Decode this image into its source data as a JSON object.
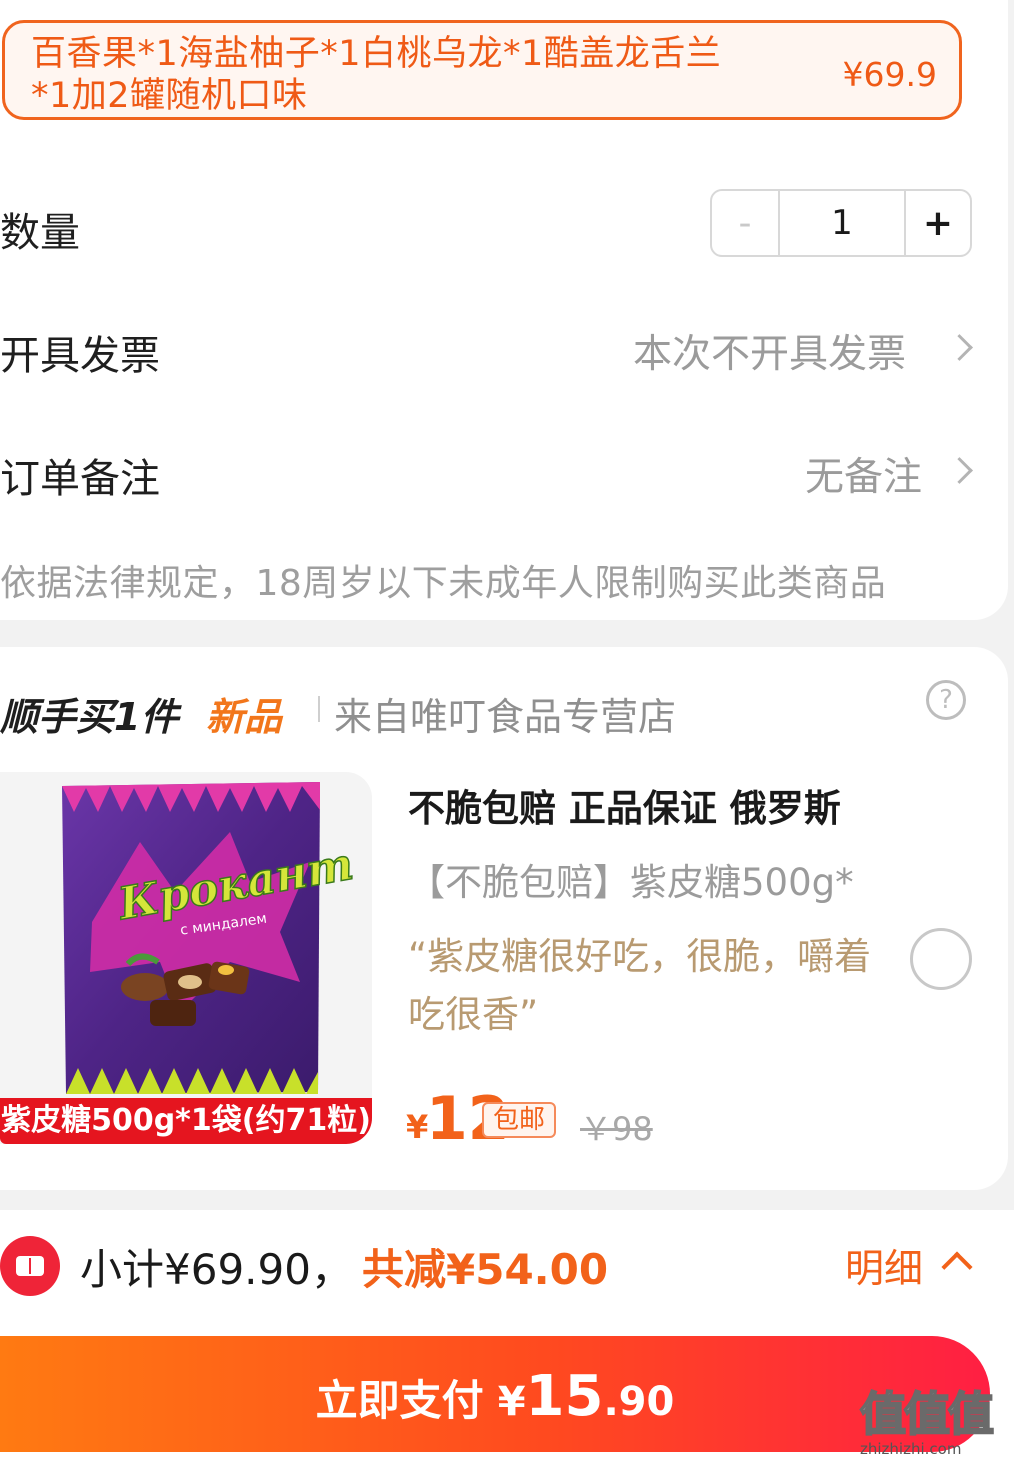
{
  "selected_sku": {
    "title": "百香果*1海盐柚子*1白桃乌龙*1酷盖龙舌兰*1加2罐随机口味",
    "price": "¥69.9"
  },
  "quantity": {
    "label": "数量",
    "minus": "-",
    "value": "1",
    "plus": "+"
  },
  "invoice": {
    "label": "开具发票",
    "value": "本次不开具发票"
  },
  "remark": {
    "label": "订单备注",
    "value": "无备注"
  },
  "notice": "依据法律规定，18周岁以下未成年人限制购买此类商品",
  "addon": {
    "title": "顺手买1件",
    "badge": "新品",
    "store": "来自唯叮食品专营店",
    "help": "?",
    "product": {
      "brand_text": "Крокант",
      "brand_sub": "с миндалем",
      "image_label": "紫皮糖500g*1袋(约71粒)",
      "name": "不脆包赔 正品保证 俄罗斯",
      "spec": "【不脆包赔】紫皮糖500g*",
      "review": "“紫皮糖很好吃，很脆，嚼着吃很香”",
      "price_symbol": "¥",
      "price": "12",
      "shipping_tag": "包邮",
      "original_price": "￥98"
    }
  },
  "summary": {
    "subtotal": "小计¥69.90，",
    "discount": "共减¥54.00",
    "detail_label": "明细"
  },
  "pay": {
    "label": "立即支付",
    "symbol": "¥",
    "amount_int": "15",
    "amount_dec": ".90"
  },
  "watermark": {
    "chars": "值值值",
    "url": "zhizhizhi.com"
  },
  "colors": {
    "accent": "#f2621a",
    "brand_red": "#ef2438",
    "review": "#b89a71",
    "candy_purple": "#5b2a8c"
  }
}
